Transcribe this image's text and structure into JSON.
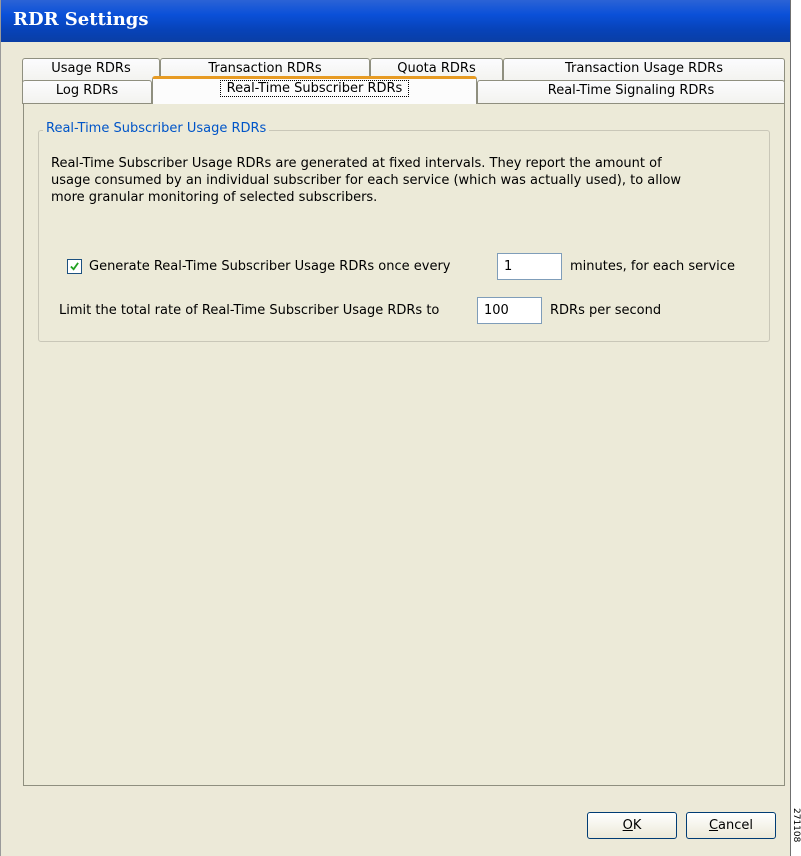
{
  "window": {
    "title": "RDR Settings"
  },
  "tabs_row1": [
    {
      "label": "Usage RDRs"
    },
    {
      "label": "Transaction RDRs"
    },
    {
      "label": "Quota RDRs"
    },
    {
      "label": "Transaction Usage RDRs"
    }
  ],
  "tabs_row2": [
    {
      "label": "Log RDRs"
    },
    {
      "label": "Real-Time Subscriber RDRs",
      "active": true
    },
    {
      "label": "Real-Time Signaling RDRs"
    }
  ],
  "group": {
    "title": "Real-Time Subscriber Usage RDRs",
    "description_lines": [
      "Real-Time Subscriber Usage RDRs are generated at fixed intervals. They report the amount of",
      "usage consumed by an individual subscriber for each service (which was actually used), to allow",
      "more granular monitoring of selected subscribers."
    ],
    "generate": {
      "checked": true,
      "label_before": "Generate Real-Time Subscriber Usage RDRs once every",
      "interval_value": "1",
      "label_after": "minutes, for each service"
    },
    "limit": {
      "label_before": "Limit the total rate of Real-Time Subscriber Usage RDRs to",
      "rate_value": "100",
      "label_after": "RDRs per second"
    }
  },
  "buttons": {
    "ok": {
      "mnemonic": "O",
      "rest": "K"
    },
    "cancel": {
      "mnemonic": "C",
      "rest": "ancel"
    }
  },
  "side_note": "271108",
  "colors": {
    "titlebar": "#0a50d8",
    "dialog_bg": "#ece9d8",
    "group_title": "#0055c8",
    "active_tab_accent": "#e79b23"
  }
}
